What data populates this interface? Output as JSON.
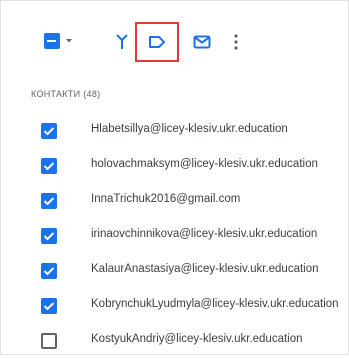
{
  "toolbar": {
    "select_all_icon": "checkbox-indeterminate-icon",
    "merge_icon": "merge-icon",
    "label_icon": "label-icon",
    "email_icon": "email-icon",
    "more_icon": "more-vertical-icon"
  },
  "colors": {
    "accent": "#1a73e8",
    "highlight_border": "#e53935",
    "text": "#3c4043",
    "muted": "#5f6368"
  },
  "section": {
    "title": "КОНТАКТИ (48)"
  },
  "contacts": [
    {
      "email": "Hlabetsillya@licey-klesiv.ukr.education",
      "checked": true
    },
    {
      "email": "holovachmaksym@licey-klesiv.ukr.education",
      "checked": true
    },
    {
      "email": "InnaTrichuk2016@gmail.com",
      "checked": true
    },
    {
      "email": "irinaovchinnikova@licey-klesiv.ukr.education",
      "checked": true
    },
    {
      "email": "KalaurAnastasiya@licey-klesiv.ukr.education",
      "checked": true
    },
    {
      "email": "KobrynchukLyudmyla@licey-klesiv.ukr.education",
      "checked": true
    },
    {
      "email": "KostyukAndriy@licey-klesiv.ukr.education",
      "checked": false
    }
  ]
}
